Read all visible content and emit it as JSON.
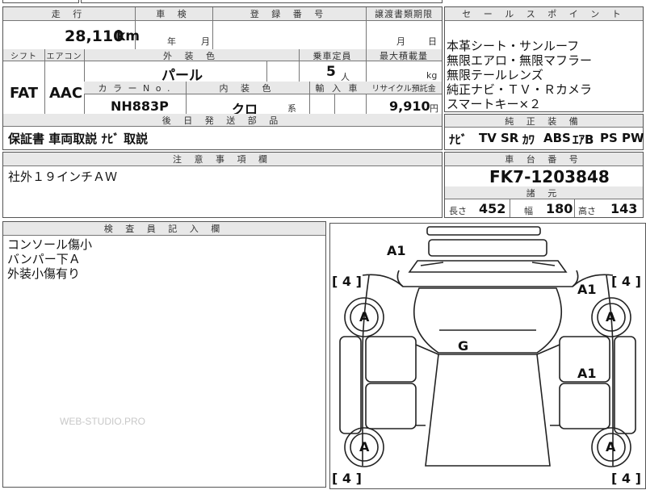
{
  "top_strip": {
    "left_text": "",
    "right_text": ""
  },
  "headers": {
    "mileage": "走 行",
    "inspection": "車 検",
    "registration": "登 録 番 号",
    "transfer_deadline": "譲渡書類期限",
    "sales_points": "セ ー ル ス ポ イ ン ト",
    "shift": "シフト",
    "aircon": "エアコン",
    "exterior_color": "外 装 色",
    "seats": "乗車定員",
    "max_load": "最大積載量",
    "color_no": "カ ラ ー N o .",
    "interior_color": "内 装 色",
    "import": "輸 入 車",
    "recycle": "リサイクル預託金",
    "later_parts": "後 日 発 送 部 品",
    "genuine_equipment": "純 正 装 備",
    "notes": "注 意 事 項 欄",
    "chassis_no": "車 台 番 号",
    "specs": "諸 元",
    "inspector": "検 査 員 記 入 欄"
  },
  "vehicle": {
    "mileage": "28,110",
    "mileage_unit": "km",
    "inspection_year_unit": "年",
    "inspection_month_unit": "月",
    "transfer_month_unit": "月",
    "transfer_day_unit": "日",
    "shift": "FAT",
    "aircon": "AAC",
    "exterior_color": "パール",
    "seats": "5",
    "seats_unit": "人",
    "max_load_unit": "kg",
    "color_no": "NH883P",
    "interior_color": "クロ",
    "interior_suffix": "系",
    "recycle_fee": "9,910",
    "recycle_unit": "円"
  },
  "sales_points": [
    "本革シート・サンルーフ",
    "無限エアロ・無限マフラー",
    "無限テールレンズ",
    "純正ナビ・ＴＶ・Ｒカメラ",
    "スマートキー×２"
  ],
  "later_parts": "保証書 車両取説 ﾅﾋﾞ 取説",
  "genuine_equipment": [
    "ﾅﾋﾞ",
    "TV",
    "SR",
    "ｶﾜ",
    "ABS",
    "ｴｱB",
    "PS",
    "PW"
  ],
  "notes": "社外１９インチＡＷ",
  "chassis_no": "FK7-1203848",
  "specs": {
    "length_label": "長さ",
    "length": "452",
    "width_label": "幅",
    "width": "180",
    "height_label": "高さ",
    "height": "143"
  },
  "inspector_notes": [
    "コンソール傷小",
    "バンパー下Ａ",
    "外装小傷有り"
  ],
  "watermark": "WEB-STUDIO.PRO",
  "car_diagram_marks": {
    "front": "A1",
    "tl_tire": "[ 4 ]",
    "tr_tire": "[ 4 ]",
    "bl_tire": "[ 4 ]",
    "br_tire": "[ 4 ]",
    "right_front_panel": "A1",
    "right_door": "A1",
    "windshield": "G",
    "wheel_fl": "A",
    "wheel_fr": "A",
    "wheel_rl": "A",
    "wheel_rr": "A"
  }
}
